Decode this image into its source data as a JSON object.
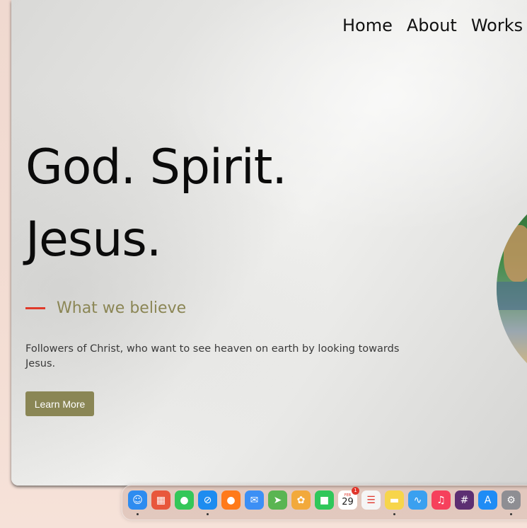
{
  "nav": {
    "items": [
      {
        "label": "Home"
      },
      {
        "label": "About"
      },
      {
        "label": "Works"
      }
    ]
  },
  "hero": {
    "title_line_1": "God. Spirit.",
    "title_line_2": "Jesus.",
    "subtitle": "What we believe",
    "description": "Followers of Christ, who want to see heaven on earth by looking towards Jesus.",
    "button_label": "Learn More"
  },
  "colors": {
    "accent_olive": "#8a8655",
    "accent_red": "#e03a2a",
    "title_text": "#0b0b0b"
  },
  "dock": {
    "calendar": {
      "month": "FEB",
      "day": "29",
      "badge": "1"
    },
    "icons": [
      {
        "name": "finder-icon",
        "color": "#2e8cf0",
        "glyph": "☺",
        "running": true
      },
      {
        "name": "launchpad-icon",
        "color": "#e8573c",
        "glyph": "▦",
        "running": false
      },
      {
        "name": "messages-icon",
        "color": "#34c759",
        "glyph": "●",
        "running": false
      },
      {
        "name": "safari-icon",
        "color": "#1d8cf0",
        "glyph": "⊘",
        "running": true
      },
      {
        "name": "firefox-icon",
        "color": "#ff7a1a",
        "glyph": "●",
        "running": false
      },
      {
        "name": "mail-icon",
        "color": "#3c8ff5",
        "glyph": "✉",
        "running": false
      },
      {
        "name": "maps-icon",
        "color": "#5ab552",
        "glyph": "➤",
        "running": false
      },
      {
        "name": "photos-icon",
        "color": "#f2a93b",
        "glyph": "✿",
        "running": false
      },
      {
        "name": "facetime-icon",
        "color": "#30c75a",
        "glyph": "■",
        "running": false
      },
      {
        "name": "calendar-icon",
        "color": "#ffffff",
        "glyph": "",
        "running": false
      },
      {
        "name": "reminders-icon",
        "color": "#f5f5f5",
        "glyph": "☰",
        "running": false
      },
      {
        "name": "notes-icon",
        "color": "#f7d54a",
        "glyph": "▬",
        "running": true
      },
      {
        "name": "freeform-icon",
        "color": "#3aa0f0",
        "glyph": "∿",
        "running": false
      },
      {
        "name": "music-icon",
        "color": "#f6405c",
        "glyph": "♫",
        "running": false
      },
      {
        "name": "slack-icon",
        "color": "#5c2f72",
        "glyph": "#",
        "running": false
      },
      {
        "name": "app-store-icon",
        "color": "#1f8cf5",
        "glyph": "A",
        "running": false
      },
      {
        "name": "system-settings-icon",
        "color": "#8e8e93",
        "glyph": "⚙",
        "running": true
      }
    ]
  }
}
